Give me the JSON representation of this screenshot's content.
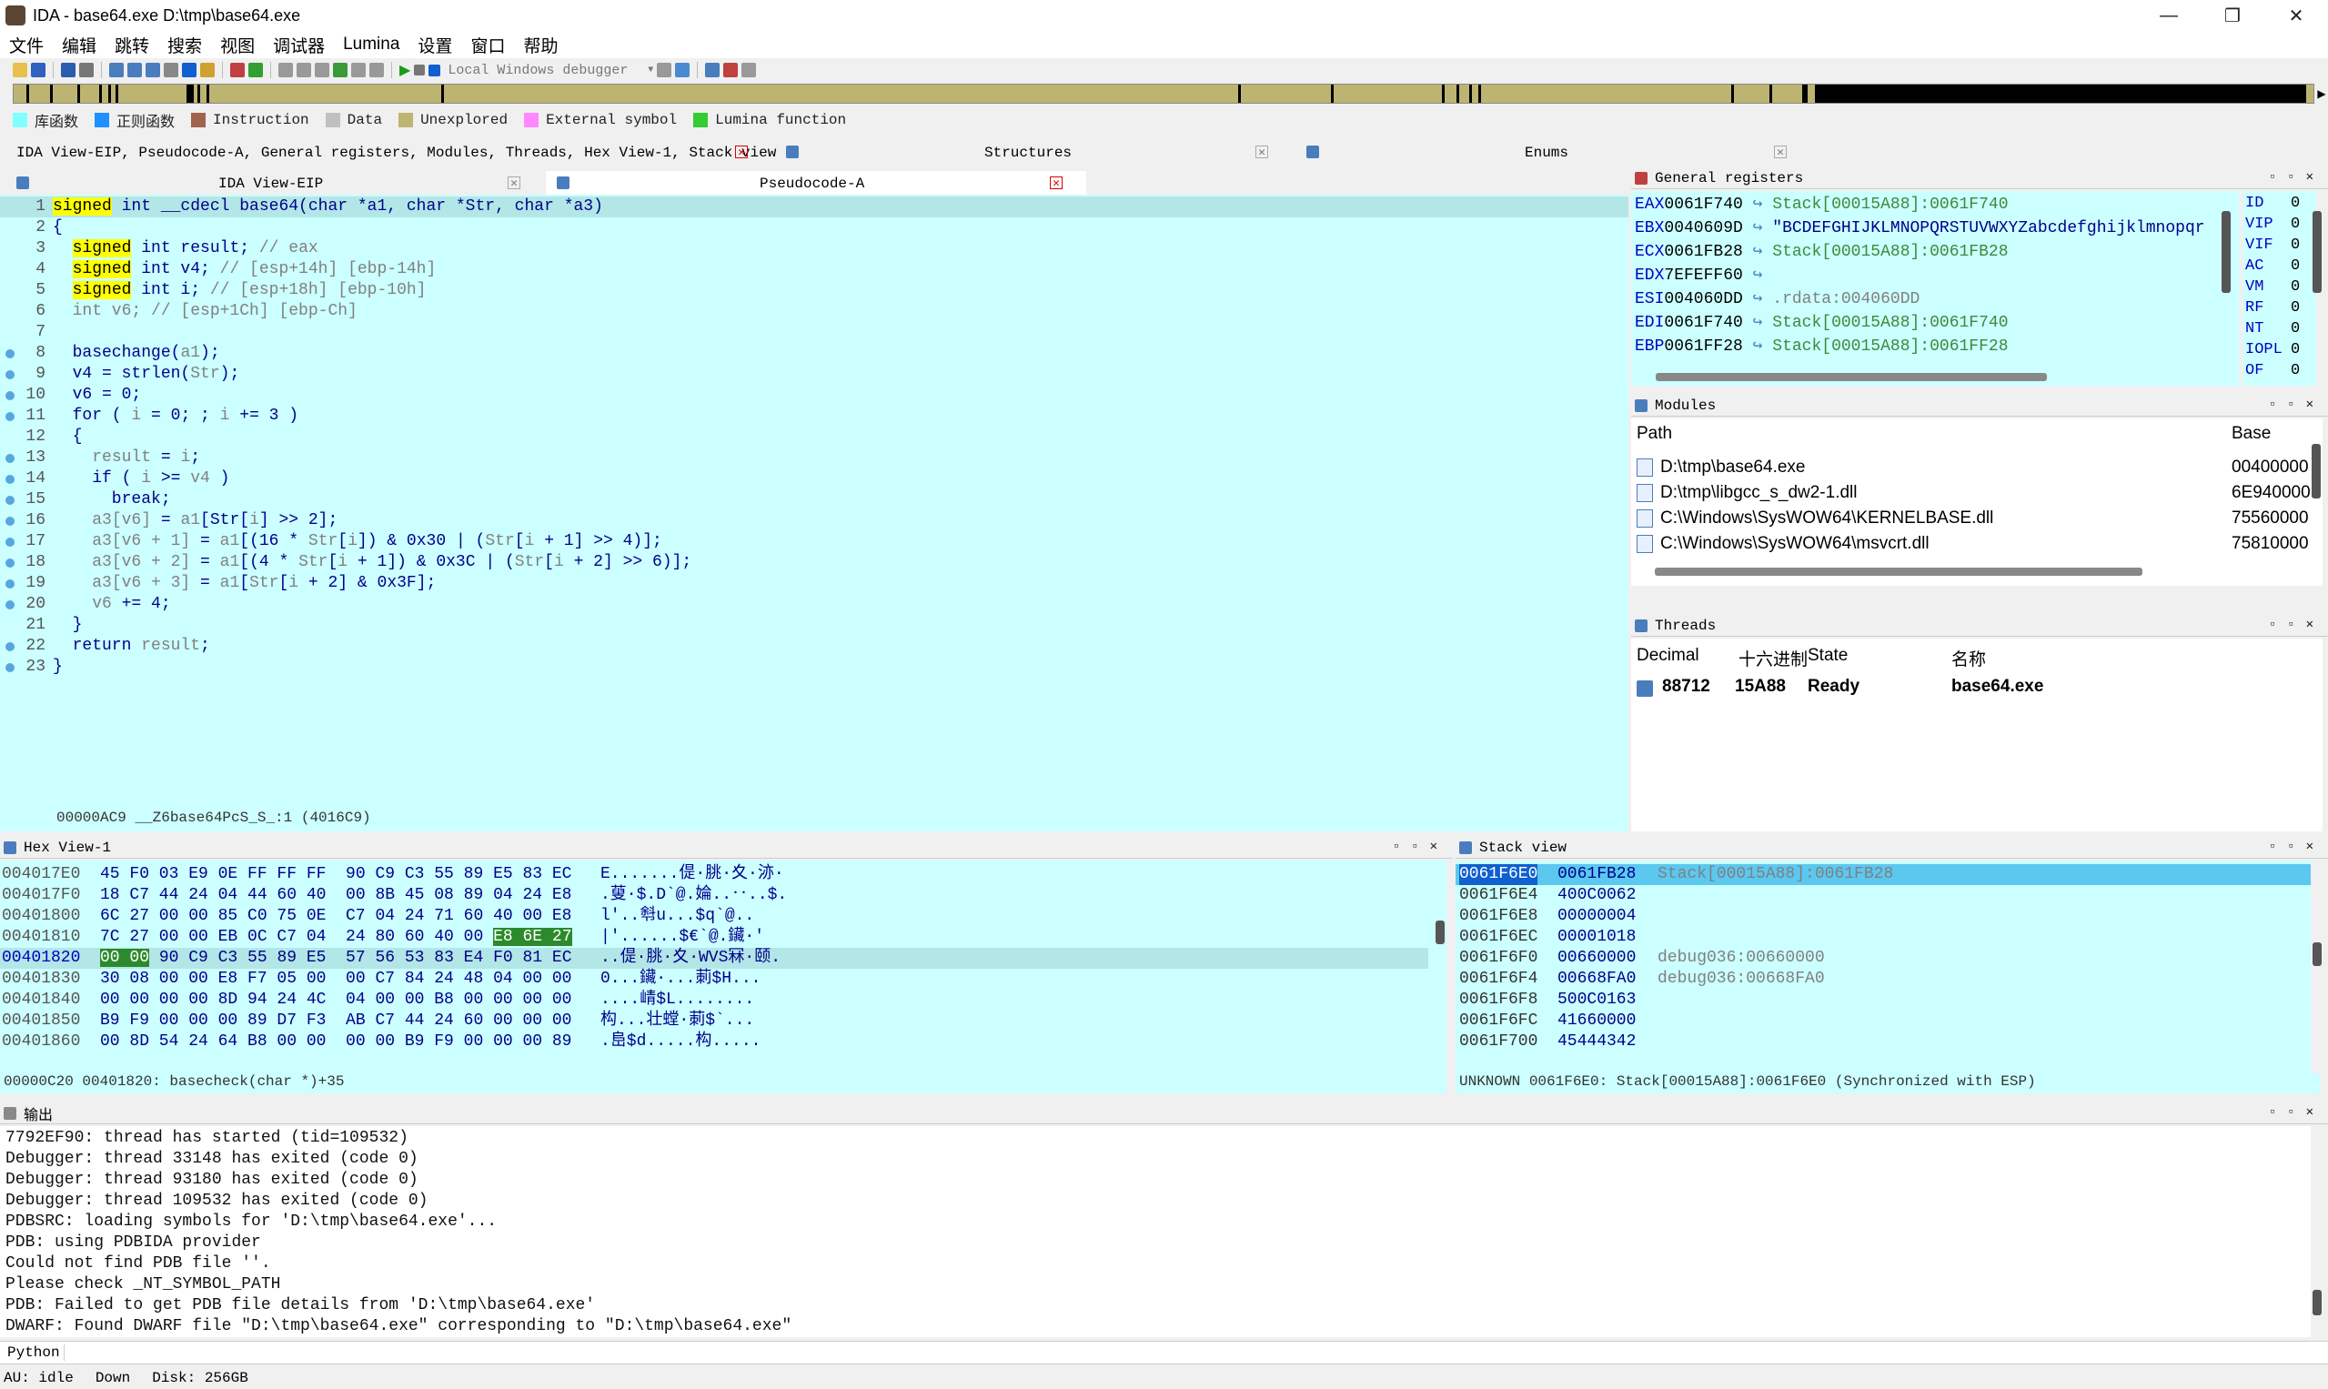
{
  "window": {
    "title": "IDA - base64.exe D:\\tmp\\base64.exe",
    "minimize": "—",
    "maximize": "❐",
    "close": "✕"
  },
  "menu": [
    "文件",
    "编辑",
    "跳转",
    "搜索",
    "视图",
    "调试器",
    "Lumina",
    "设置",
    "窗口",
    "帮助"
  ],
  "toolbar": {
    "debugger_select": "Local Windows debugger"
  },
  "legend": [
    {
      "label": "库函数",
      "color": "#80ffff"
    },
    {
      "label": "正则函数",
      "color": "#1e90ff"
    },
    {
      "label": "Instruction",
      "color": "#a0644c"
    },
    {
      "label": "Data",
      "color": "#c0c0c0"
    },
    {
      "label": "Unexplored",
      "color": "#bdb471"
    },
    {
      "label": "External symbol",
      "color": "#ff88ff"
    },
    {
      "label": "Lumina function",
      "color": "#33cc33"
    }
  ],
  "tabs": {
    "main": "IDA View-EIP, Pseudocode-A, General registers, Modules, Threads, Hex View-1, Stack view",
    "structures": "Structures",
    "enums": "Enums",
    "ida_view_eip": "IDA View-EIP",
    "pseudocode": "Pseudocode-A"
  },
  "code": {
    "lines": [
      {
        "n": "1",
        "bp": false,
        "parts": [
          [
            "kw",
            "signed"
          ],
          [
            "t",
            " int __cdecl base64(char *a1, char *Str, char *a3)"
          ]
        ]
      },
      {
        "n": "2",
        "bp": false,
        "parts": [
          [
            "t",
            "{"
          ]
        ]
      },
      {
        "n": "3",
        "bp": false,
        "parts": [
          [
            "t",
            "  "
          ],
          [
            "kw",
            "signed"
          ],
          [
            "t",
            " int result; "
          ],
          [
            "c",
            "// eax"
          ]
        ]
      },
      {
        "n": "4",
        "bp": false,
        "parts": [
          [
            "t",
            "  "
          ],
          [
            "kw",
            "signed"
          ],
          [
            "t",
            " int v4; "
          ],
          [
            "c",
            "// [esp+14h] [ebp-14h]"
          ]
        ]
      },
      {
        "n": "5",
        "bp": false,
        "parts": [
          [
            "t",
            "  "
          ],
          [
            "kw",
            "signed"
          ],
          [
            "t",
            " int i; "
          ],
          [
            "c",
            "// [esp+18h] [ebp-10h]"
          ]
        ]
      },
      {
        "n": "6",
        "bp": false,
        "parts": [
          [
            "g",
            "  int v6; // [esp+1Ch] [ebp-Ch]"
          ]
        ]
      },
      {
        "n": "7",
        "bp": false,
        "parts": [
          [
            "t",
            ""
          ]
        ]
      },
      {
        "n": "8",
        "bp": true,
        "parts": [
          [
            "t",
            "  basechange("
          ],
          [
            "g",
            "a1"
          ],
          [
            "t",
            ");"
          ]
        ]
      },
      {
        "n": "9",
        "bp": true,
        "parts": [
          [
            "t",
            "  v4 = strlen("
          ],
          [
            "g",
            "Str"
          ],
          [
            "t",
            ");"
          ]
        ]
      },
      {
        "n": "10",
        "bp": true,
        "parts": [
          [
            "t",
            "  v6 = 0;"
          ]
        ]
      },
      {
        "n": "11",
        "bp": true,
        "parts": [
          [
            "t",
            "  for ( "
          ],
          [
            "g",
            "i"
          ],
          [
            "t",
            " = 0; ; "
          ],
          [
            "g",
            "i"
          ],
          [
            "t",
            " += 3 )"
          ]
        ]
      },
      {
        "n": "12",
        "bp": false,
        "parts": [
          [
            "t",
            "  {"
          ]
        ]
      },
      {
        "n": "13",
        "bp": true,
        "parts": [
          [
            "t",
            "    "
          ],
          [
            "g",
            "result"
          ],
          [
            "t",
            " = "
          ],
          [
            "g",
            "i"
          ],
          [
            "t",
            ";"
          ]
        ]
      },
      {
        "n": "14",
        "bp": true,
        "parts": [
          [
            "t",
            "    if ( "
          ],
          [
            "g",
            "i"
          ],
          [
            "t",
            " >= "
          ],
          [
            "g",
            "v4"
          ],
          [
            "t",
            " )"
          ]
        ]
      },
      {
        "n": "15",
        "bp": true,
        "parts": [
          [
            "t",
            "      break;"
          ]
        ]
      },
      {
        "n": "16",
        "bp": true,
        "parts": [
          [
            "t",
            "    "
          ],
          [
            "g",
            "a3[v6]"
          ],
          [
            "t",
            " = "
          ],
          [
            "g",
            "a1"
          ],
          [
            "t",
            "[Str["
          ],
          [
            "g",
            "i"
          ],
          [
            "t",
            "] >> 2];"
          ]
        ]
      },
      {
        "n": "17",
        "bp": true,
        "parts": [
          [
            "t",
            "    "
          ],
          [
            "g",
            "a3[v6 + 1]"
          ],
          [
            "t",
            " = "
          ],
          [
            "g",
            "a1"
          ],
          [
            "t",
            "[(16 * "
          ],
          [
            "g",
            "Str"
          ],
          [
            "t",
            "["
          ],
          [
            "g",
            "i"
          ],
          [
            "t",
            "]) & 0x30 | ("
          ],
          [
            "g",
            "Str"
          ],
          [
            "t",
            "["
          ],
          [
            "g",
            "i"
          ],
          [
            "t",
            " + 1] >> 4)];"
          ]
        ]
      },
      {
        "n": "18",
        "bp": true,
        "parts": [
          [
            "t",
            "    "
          ],
          [
            "g",
            "a3[v6 + 2]"
          ],
          [
            "t",
            " = "
          ],
          [
            "g",
            "a1"
          ],
          [
            "t",
            "[(4 * "
          ],
          [
            "g",
            "Str"
          ],
          [
            "t",
            "["
          ],
          [
            "g",
            "i"
          ],
          [
            "t",
            " + 1]) & 0x3C | ("
          ],
          [
            "g",
            "Str"
          ],
          [
            "t",
            "["
          ],
          [
            "g",
            "i"
          ],
          [
            "t",
            " + 2] >> 6)];"
          ]
        ]
      },
      {
        "n": "19",
        "bp": true,
        "parts": [
          [
            "t",
            "    "
          ],
          [
            "g",
            "a3[v6 + 3]"
          ],
          [
            "t",
            " = "
          ],
          [
            "g",
            "a1"
          ],
          [
            "t",
            "["
          ],
          [
            "g",
            "Str"
          ],
          [
            "t",
            "["
          ],
          [
            "g",
            "i"
          ],
          [
            "t",
            " + 2] & 0x3F];"
          ]
        ]
      },
      {
        "n": "20",
        "bp": true,
        "parts": [
          [
            "t",
            "    "
          ],
          [
            "g",
            "v6"
          ],
          [
            "t",
            " += 4;"
          ]
        ]
      },
      {
        "n": "21",
        "bp": false,
        "parts": [
          [
            "t",
            "  }"
          ]
        ]
      },
      {
        "n": "22",
        "bp": true,
        "parts": [
          [
            "t",
            "  return "
          ],
          [
            "g",
            "result"
          ],
          [
            "t",
            ";"
          ]
        ]
      },
      {
        "n": "23",
        "bp": true,
        "parts": [
          [
            "t",
            "}"
          ]
        ]
      }
    ],
    "status": "00000AC9 __Z6base64PcS_S_:1 (4016C9)"
  },
  "registers": {
    "title": "General registers",
    "rows": [
      {
        "name": "EAX",
        "val": "0061F740",
        "ptr": "Stack[00015A88]:0061F740"
      },
      {
        "name": "EBX",
        "val": "0040609D",
        "ptr": "\"BCDEFGHIJKLMNOPQRSTUVWXYZabcdefghijklmnopqr"
      },
      {
        "name": "ECX",
        "val": "0061FB28",
        "ptr": "Stack[00015A88]:0061FB28"
      },
      {
        "name": "EDX",
        "val": "7EFEFF60",
        "ptr": ""
      },
      {
        "name": "ESI",
        "val": "004060DD",
        "ptr": ".rdata:004060DD"
      },
      {
        "name": "EDI",
        "val": "0061F740",
        "ptr": "Stack[00015A88]:0061F740"
      },
      {
        "name": "EBP",
        "val": "0061FF28",
        "ptr": "Stack[00015A88]:0061FF28"
      }
    ],
    "flags": [
      {
        "n": "ID",
        "v": "0"
      },
      {
        "n": "VIP",
        "v": "0"
      },
      {
        "n": "VIF",
        "v": "0"
      },
      {
        "n": "AC",
        "v": "0"
      },
      {
        "n": "VM",
        "v": "0"
      },
      {
        "n": "RF",
        "v": "0"
      },
      {
        "n": "NT",
        "v": "0"
      },
      {
        "n": "IOPL",
        "v": "0"
      },
      {
        "n": "OF",
        "v": "0"
      }
    ]
  },
  "modules": {
    "title": "Modules",
    "col_path": "Path",
    "col_base": "Base",
    "rows": [
      {
        "path": "D:\\tmp\\base64.exe",
        "base": "00400000"
      },
      {
        "path": "D:\\tmp\\libgcc_s_dw2-1.dll",
        "base": "6E940000"
      },
      {
        "path": "C:\\Windows\\SysWOW64\\KERNELBASE.dll",
        "base": "75560000"
      },
      {
        "path": "C:\\Windows\\SysWOW64\\msvcrt.dll",
        "base": "75810000"
      }
    ]
  },
  "threads": {
    "title": "Threads",
    "cols": [
      "Decimal",
      "十六进制",
      "State",
      "名称"
    ],
    "row": {
      "decimal": "88712",
      "hex": "15A88",
      "state": "Ready",
      "name": "base64.exe"
    }
  },
  "hex": {
    "title": "Hex View-1",
    "rows": [
      {
        "addr": "004017E0",
        "bytes": "45 F0 03 E9 0E FF FF FF  90 C9 C3 55 89 E5 83 EC",
        "ascii": "E.......偍·朓·夊·洂·"
      },
      {
        "addr": "004017F0",
        "bytes": "18 C7 44 24 04 44 60 40  00 8B 45 08 89 04 24 E8",
        "ascii": ".蓃·$.D`@.婨..‥..$."
      },
      {
        "addr": "00401800",
        "bytes": "6C 27 00 00 85 C0 75 0E  C7 04 24 71 60 40 00 E8",
        "ascii": "l'..厁u...$q`@.."
      },
      {
        "addr": "00401810",
        "bytes": "7C 27 00 00 EB 0C C7 04  24 80 60 40 00 ",
        "ascii": "|'......$€`@.鑶·'",
        "hl_tail": "E8 6E 27"
      },
      {
        "addr": "00401820",
        "bytes": "90 C9 C3 55 89 E5  57 56 53 83 E4 F0 81 EC",
        "ascii": "..偍·朓·夊·WVS冧·颐.",
        "hl_head": "00 00",
        "current": true
      },
      {
        "addr": "00401830",
        "bytes": "30 08 00 00 E8 F7 05 00  00 C7 84 24 48 04 00 00",
        "ascii": "0...鑶·...莿$H..."
      },
      {
        "addr": "00401840",
        "bytes": "00 00 00 00 8D 94 24 4C  04 00 00 B8 00 00 00 00",
        "ascii": "....崝$L........"
      },
      {
        "addr": "00401850",
        "bytes": "B9 F9 00 00 00 89 D7 F3  AB C7 44 24 60 00 00 00",
        "ascii": "构...壮螳·莿$`..."
      },
      {
        "addr": "00401860",
        "bytes": "00 8D 54 24 64 B8 00 00  00 00 B9 F9 00 00 00 89",
        "ascii": ".峊$d.....构....."
      }
    ],
    "status": "00000C20 00401820: basecheck(char *)+35"
  },
  "stack": {
    "title": "Stack view",
    "rows": [
      {
        "addr": "0061F6E0",
        "val": "0061FB28",
        "cmt": "Stack[00015A88]:0061FB28",
        "current": true
      },
      {
        "addr": "0061F6E4",
        "val": "400C0062",
        "cmt": ""
      },
      {
        "addr": "0061F6E8",
        "val": "00000004",
        "cmt": ""
      },
      {
        "addr": "0061F6EC",
        "val": "00001018",
        "cmt": ""
      },
      {
        "addr": "0061F6F0",
        "val": "00660000",
        "cmt": "debug036:00660000"
      },
      {
        "addr": "0061F6F4",
        "val": "00668FA0",
        "cmt": "debug036:00668FA0"
      },
      {
        "addr": "0061F6F8",
        "val": "500C0163",
        "cmt": ""
      },
      {
        "addr": "0061F6FC",
        "val": "41660000",
        "cmt": ""
      },
      {
        "addr": "0061F700",
        "val": "45444342",
        "cmt": ""
      }
    ],
    "status": "UNKNOWN 0061F6E0: Stack[00015A88]:0061F6E0 (Synchronized with ESP)"
  },
  "output": {
    "title": "输出",
    "lines": [
      "7792EF90: thread has started (tid=109532)",
      "Debugger: thread 33148 has exited (code 0)",
      "Debugger: thread 93180 has exited (code 0)",
      "Debugger: thread 109532 has exited (code 0)",
      "PDBSRC: loading symbols for 'D:\\tmp\\base64.exe'...",
      "PDB: using PDBIDA provider",
      "Could not find PDB file ''.",
      "Please check _NT_SYMBOL_PATH",
      "PDB: Failed to get PDB file details from 'D:\\tmp\\base64.exe'",
      "DWARF: Found DWARF file \"D:\\tmp\\base64.exe\" corresponding to \"D:\\tmp\\base64.exe\""
    ],
    "python_label": "Python"
  },
  "status": {
    "au": "AU:  idle",
    "dir": "Down",
    "disk": "Disk: 256GB"
  }
}
